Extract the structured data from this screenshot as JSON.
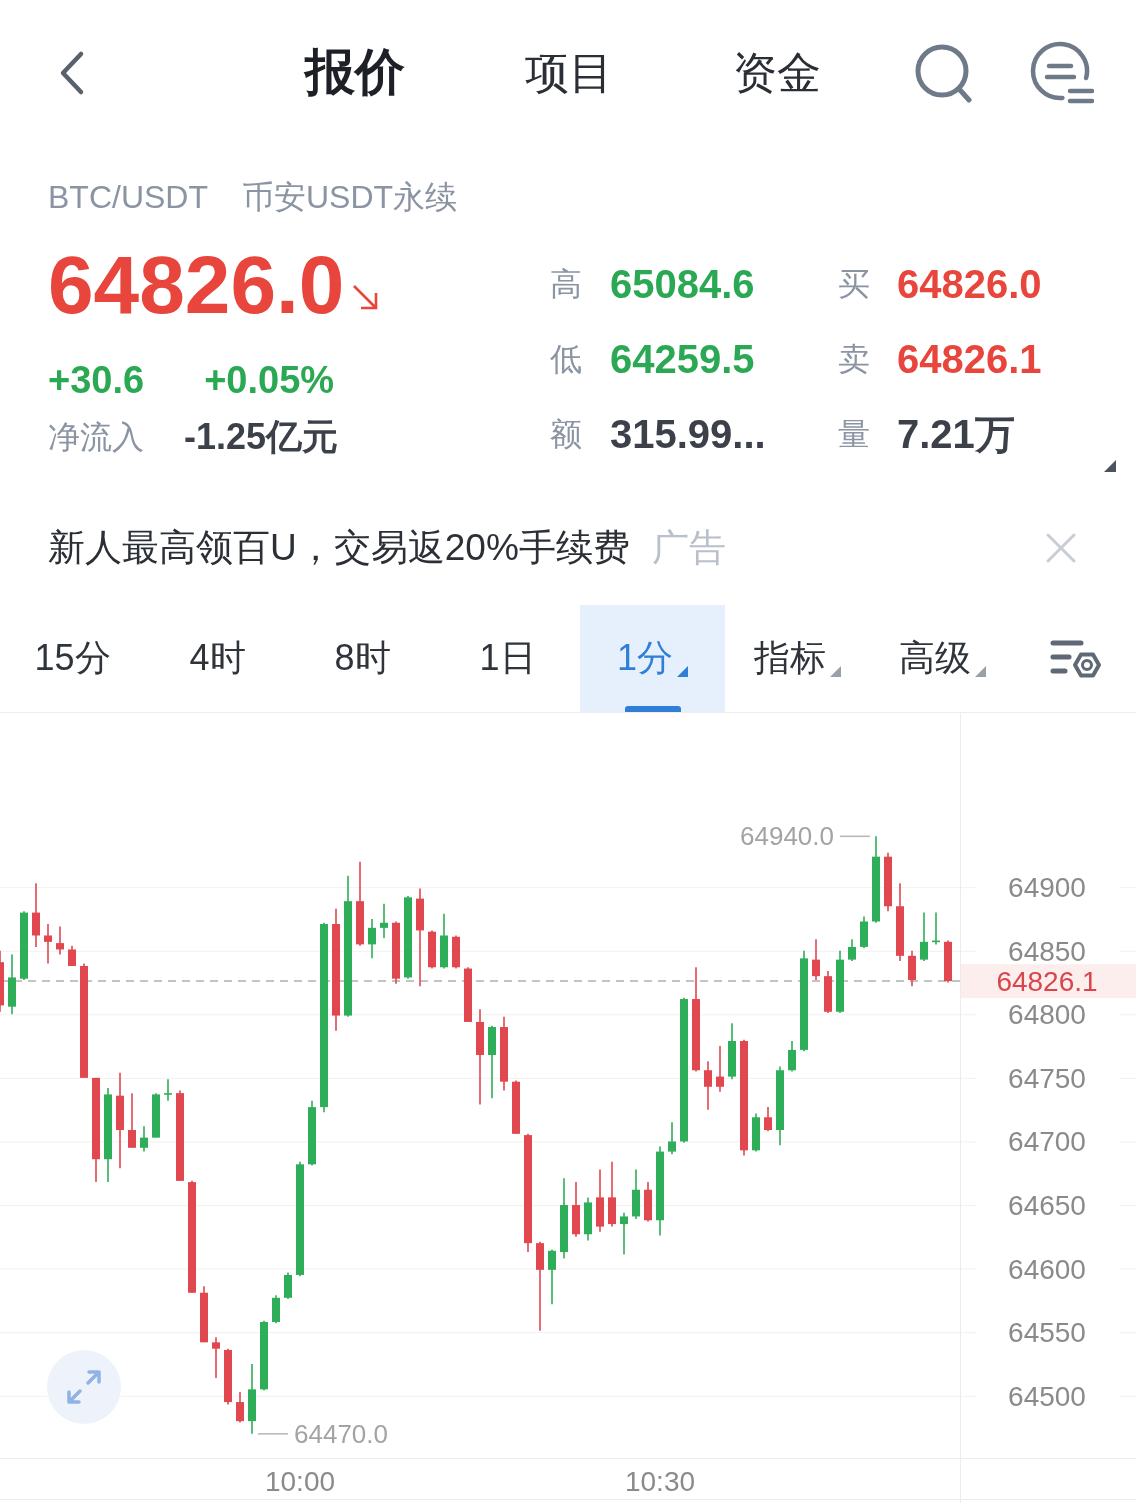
{
  "header": {
    "tabs": [
      {
        "label": "报价",
        "selected": true
      },
      {
        "label": "项目",
        "selected": false
      },
      {
        "label": "资金",
        "selected": false
      }
    ]
  },
  "instrument": {
    "symbol": "BTC/USDT",
    "market": "币安USDT永续"
  },
  "quote": {
    "price": "64826.0",
    "price_falling": true,
    "change": "+30.6",
    "change_percent": "+0.05%",
    "change_rising": true,
    "net_inflow_label": "净流入",
    "net_inflow": "-1.25亿元"
  },
  "stats": [
    {
      "label": "高",
      "value": "65084.6",
      "color": "#2ba853"
    },
    {
      "label": "买",
      "value": "64826.0",
      "color": "#e8453c"
    },
    {
      "label": "低",
      "value": "64259.5",
      "color": "#2ba853"
    },
    {
      "label": "卖",
      "value": "64826.1",
      "color": "#e8453c"
    },
    {
      "label": "额",
      "value": "315.99...",
      "color": "#3b4049"
    },
    {
      "label": "量",
      "value": "7.21万",
      "color": "#3b4049"
    }
  ],
  "ad": {
    "text": "新人最高领百U，交易返20%手续费",
    "tag": "广告"
  },
  "intervals": [
    {
      "label": "15分",
      "selected": false,
      "kind": "plain"
    },
    {
      "label": "4时",
      "selected": false,
      "kind": "plain"
    },
    {
      "label": "8时",
      "selected": false,
      "kind": "plain"
    },
    {
      "label": "1日",
      "selected": false,
      "kind": "plain"
    },
    {
      "label": "1分",
      "selected": true,
      "kind": "dropdown"
    },
    {
      "label": "指标",
      "selected": false,
      "kind": "dropdown"
    },
    {
      "label": "高级",
      "selected": false,
      "kind": "dropdown"
    }
  ],
  "chart": {
    "chart_data": {
      "type": "candlestick",
      "grid": true,
      "ylim": [
        64451,
        65037
      ],
      "yticks": [
        64900,
        64850,
        64800,
        64750,
        64700,
        64650,
        64600,
        64550,
        64500
      ],
      "categories": [
        null,
        null,
        null,
        null,
        null,
        null,
        null,
        null,
        null,
        null,
        null,
        null,
        null,
        null,
        null,
        null,
        null,
        null,
        null,
        null,
        null,
        null,
        null,
        null,
        null,
        "10:00",
        null,
        null,
        null,
        null,
        null,
        null,
        null,
        null,
        null,
        null,
        null,
        null,
        null,
        null,
        null,
        null,
        null,
        null,
        null,
        null,
        null,
        null,
        null,
        null,
        null,
        null,
        null,
        null,
        null,
        "10:30",
        null,
        null,
        null,
        null,
        null,
        null,
        null,
        null,
        null,
        null,
        null,
        null,
        null,
        null,
        null,
        null,
        null,
        null,
        null,
        null,
        null,
        null,
        null,
        null
      ],
      "ohlc": [
        [
          64841,
          64850,
          64802,
          64807
        ],
        [
          64806,
          64847,
          64800,
          64829
        ],
        [
          64828,
          64881,
          64827,
          64880
        ],
        [
          64880,
          64903,
          64853,
          64862
        ],
        [
          64862,
          64871,
          64840,
          64857
        ],
        [
          64856,
          64869,
          64847,
          64851
        ],
        [
          64851,
          64854,
          64838,
          64838
        ],
        [
          64838,
          64840,
          64750,
          64750
        ],
        [
          64750,
          64750,
          64668,
          64686
        ],
        [
          64686,
          64742,
          64668,
          64737
        ],
        [
          64736,
          64754,
          64679,
          64709
        ],
        [
          64709,
          64738,
          64695,
          64695
        ],
        [
          64695,
          64712,
          64692,
          64703
        ],
        [
          64703,
          64738,
          64703,
          64737
        ],
        [
          64737,
          64749,
          64732,
          64738
        ],
        [
          64738,
          64740,
          64669,
          64669
        ],
        [
          64668,
          64669,
          64581,
          64581
        ],
        [
          64581,
          64586,
          64542,
          64542
        ],
        [
          64542,
          64546,
          64514,
          64537
        ],
        [
          64536,
          64537,
          64493,
          64495
        ],
        [
          64495,
          64503,
          64479,
          64480
        ],
        [
          64480,
          64525,
          64470,
          64505
        ],
        [
          64505,
          64559,
          64504,
          64558
        ],
        [
          64558,
          64579,
          64557,
          64577
        ],
        [
          64577,
          64597,
          64576,
          64595
        ],
        [
          64595,
          64684,
          64594,
          64682
        ],
        [
          64682,
          64732,
          64681,
          64727
        ],
        [
          64727,
          64872,
          64723,
          64871
        ],
        [
          64871,
          64883,
          64787,
          64799
        ],
        [
          64799,
          64909,
          64798,
          64889
        ],
        [
          64889,
          64920,
          64854,
          64855
        ],
        [
          64855,
          64875,
          64844,
          64868
        ],
        [
          64868,
          64887,
          64860,
          64872
        ],
        [
          64872,
          64873,
          64824,
          64828
        ],
        [
          64829,
          64893,
          64828,
          64892
        ],
        [
          64891,
          64899,
          64822,
          64866
        ],
        [
          64865,
          64866,
          64836,
          64837
        ],
        [
          64837,
          64879,
          64836,
          64862
        ],
        [
          64861,
          64862,
          64836,
          64837
        ],
        [
          64836,
          64837,
          64794,
          64794
        ],
        [
          64794,
          64804,
          64729,
          64768
        ],
        [
          64768,
          64791,
          64734,
          64790
        ],
        [
          64790,
          64798,
          64740,
          64747
        ],
        [
          64747,
          64748,
          64706,
          64706
        ],
        [
          64705,
          64706,
          64613,
          64620
        ],
        [
          64620,
          64621,
          64551,
          64599
        ],
        [
          64599,
          64615,
          64572,
          64614
        ],
        [
          64613,
          64671,
          64608,
          64650
        ],
        [
          64650,
          64668,
          64625,
          64627
        ],
        [
          64627,
          64656,
          64622,
          64652
        ],
        [
          64656,
          64678,
          64629,
          64633
        ],
        [
          64656,
          64684,
          64633,
          64635
        ],
        [
          64635,
          64644,
          64611,
          64641
        ],
        [
          64641,
          64678,
          64639,
          64662
        ],
        [
          64662,
          64668,
          64637,
          64638
        ],
        [
          64638,
          64696,
          64626,
          64692
        ],
        [
          64692,
          64715,
          64690,
          64700
        ],
        [
          64700,
          64813,
          64699,
          64812
        ],
        [
          64812,
          64837,
          64755,
          64756
        ],
        [
          64756,
          64763,
          64725,
          64743
        ],
        [
          64751,
          64775,
          64739,
          64743
        ],
        [
          64751,
          64793,
          64749,
          64779
        ],
        [
          64779,
          64780,
          64689,
          64693
        ],
        [
          64693,
          64722,
          64692,
          64719
        ],
        [
          64719,
          64727,
          64708,
          64709
        ],
        [
          64709,
          64759,
          64697,
          64756
        ],
        [
          64756,
          64779,
          64755,
          64772
        ],
        [
          64772,
          64850,
          64771,
          64844
        ],
        [
          64843,
          64859,
          64827,
          64830
        ],
        [
          64830,
          64834,
          64801,
          64802
        ],
        [
          64802,
          64850,
          64801,
          64843
        ],
        [
          64843,
          64859,
          64842,
          64853
        ],
        [
          64853,
          64877,
          64852,
          64873
        ],
        [
          64873,
          64940,
          64872,
          64924
        ],
        [
          64924,
          64927,
          64881,
          64885
        ],
        [
          64885,
          64903,
          64842,
          64846
        ],
        [
          64846,
          64850,
          64822,
          64827
        ],
        [
          64843,
          64880,
          64842,
          64857
        ],
        [
          64857,
          64880,
          64855,
          64858
        ],
        [
          64857,
          64858,
          64825,
          64826.1
        ]
      ],
      "annotations": [
        "64940.0",
        "64470.0"
      ],
      "ref_lines": [
        {
          "axis": "y",
          "value": 64826.1,
          "label": "64826.1"
        }
      ]
    }
  }
}
